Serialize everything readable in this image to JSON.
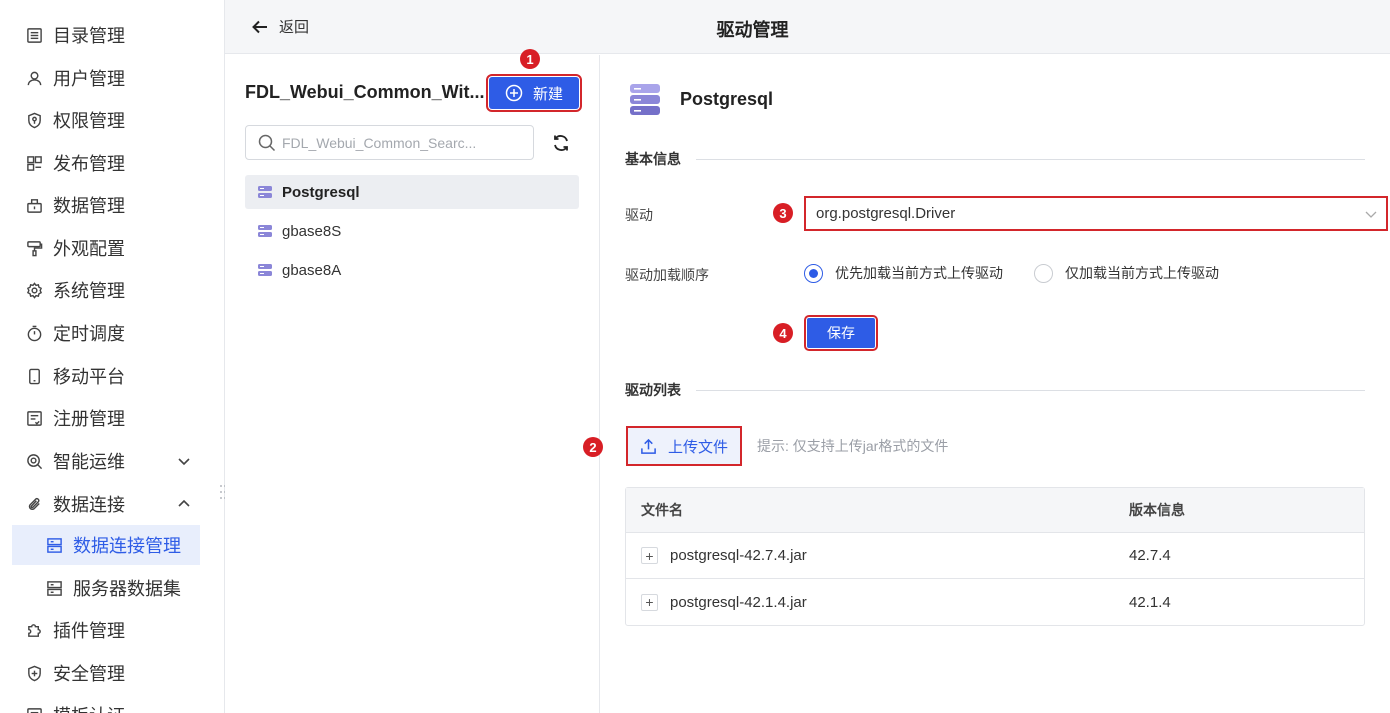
{
  "sidebar": {
    "items": [
      {
        "label": "目录管理",
        "icon": "catalog-icon"
      },
      {
        "label": "用户管理",
        "icon": "user-icon"
      },
      {
        "label": "权限管理",
        "icon": "shield-key-icon"
      },
      {
        "label": "发布管理",
        "icon": "publish-icon"
      },
      {
        "label": "数据管理",
        "icon": "data-icon"
      },
      {
        "label": "外观配置",
        "icon": "paint-roller-icon"
      },
      {
        "label": "系统管理",
        "icon": "gear-icon"
      },
      {
        "label": "定时调度",
        "icon": "stopwatch-icon"
      },
      {
        "label": "移动平台",
        "icon": "mobile-icon"
      },
      {
        "label": "注册管理",
        "icon": "register-icon"
      },
      {
        "label": "智能运维",
        "icon": "ops-icon",
        "expanded": false
      },
      {
        "label": "数据连接",
        "icon": "paperclip-icon",
        "expanded": true
      },
      {
        "label": "数据连接管理",
        "icon": "server-icon",
        "active": true
      },
      {
        "label": "服务器数据集",
        "icon": "server-dataset-icon"
      },
      {
        "label": "插件管理",
        "icon": "puzzle-icon"
      },
      {
        "label": "安全管理",
        "icon": "shield-plus-icon"
      },
      {
        "label": "模板认证",
        "icon": "template-icon"
      }
    ]
  },
  "topbar": {
    "back_label": "返回",
    "title": "驱动管理"
  },
  "list_panel": {
    "title": "FDL_Webui_Common_Wit...",
    "new_button": "新建",
    "search_placeholder": "FDL_Webui_Common_Searc...",
    "items": [
      {
        "label": "Postgresql",
        "selected": true
      },
      {
        "label": "gbase8S",
        "selected": false
      },
      {
        "label": "gbase8A",
        "selected": false
      }
    ]
  },
  "detail": {
    "name": "Postgresql",
    "basic_info_title": "基本信息",
    "driver_label": "驱动",
    "driver_value": "org.postgresql.Driver",
    "load_order_label": "驱动加载顺序",
    "load_options": [
      {
        "label": "优先加载当前方式上传驱动",
        "checked": true
      },
      {
        "label": "仅加载当前方式上传驱动",
        "checked": false
      }
    ],
    "save_button": "保存",
    "driver_list_title": "驱动列表",
    "upload_button": "上传文件",
    "upload_hint": "提示: 仅支持上传jar格式的文件",
    "table": {
      "columns": [
        "文件名",
        "版本信息"
      ],
      "rows": [
        {
          "file": "postgresql-42.7.4.jar",
          "version": "42.7.4"
        },
        {
          "file": "postgresql-42.1.4.jar",
          "version": "42.1.4"
        }
      ]
    }
  },
  "callouts": [
    "1",
    "2",
    "3",
    "4"
  ],
  "colors": {
    "accent": "#2e5ce6",
    "callout_red": "#d81e25",
    "highlight_border": "#d3262b",
    "active_nav_bg": "#e8eefc",
    "db_icon": "#8b86d8"
  }
}
